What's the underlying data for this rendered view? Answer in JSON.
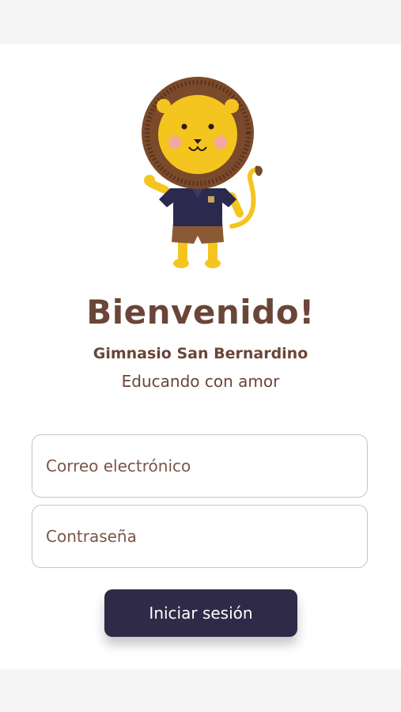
{
  "welcome": {
    "title": "Bienvenido!",
    "school_name": "Gimnasio San Bernardino",
    "motto": "Educando con amor"
  },
  "form": {
    "email_placeholder": "Correo electrónico",
    "password_placeholder": "Contraseña",
    "submit_label": "Iniciar sesión"
  },
  "colors": {
    "brand_brown": "#6a4538",
    "button": "#2f2a48",
    "lion_yellow": "#f4c51f",
    "mane": "#7a4a2b"
  },
  "icons": {
    "mascot": "lion-mascot-icon"
  }
}
